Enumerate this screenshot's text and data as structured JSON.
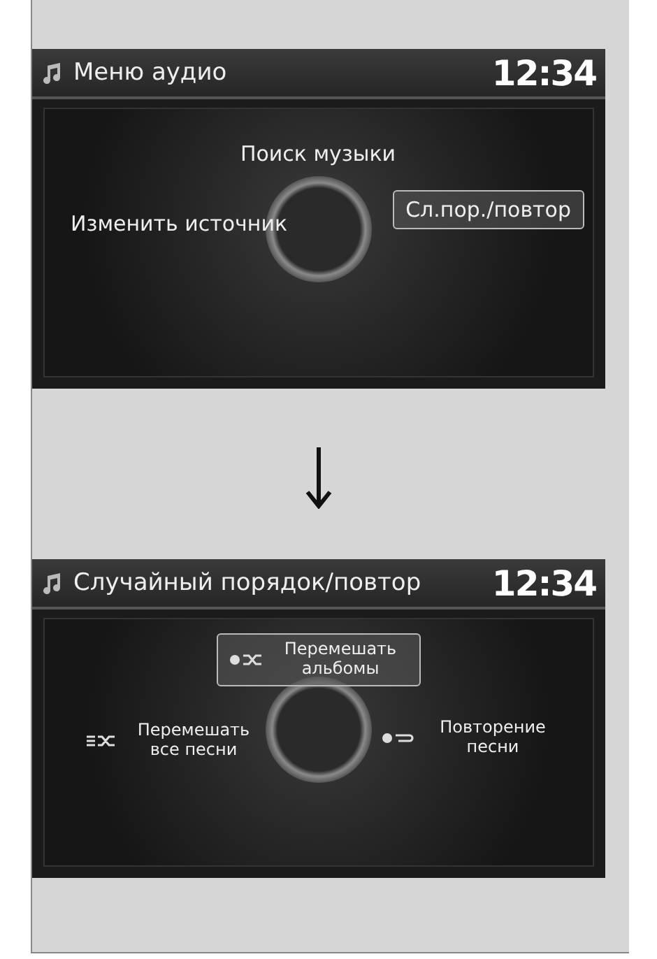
{
  "screens": [
    {
      "title": "Меню аудио",
      "time": "12:34",
      "options": {
        "top": {
          "label": "Поиск музыки",
          "kind": "plain",
          "selected": false
        },
        "left": {
          "label": "Изменить источник",
          "kind": "plain",
          "selected": false
        },
        "right": {
          "label": "Сл.пор./повтор",
          "kind": "plain",
          "selected": true
        }
      }
    },
    {
      "title": "Случайный порядок/повтор",
      "time": "12:34",
      "options": {
        "top": {
          "label": "Перемешать альбомы",
          "kind": "shuffle-album",
          "selected": true
        },
        "left": {
          "label": "Перемешать все песни",
          "kind": "shuffle-all",
          "selected": false
        },
        "right": {
          "label": "Повторение песни",
          "kind": "repeat-one",
          "selected": false
        }
      }
    }
  ]
}
